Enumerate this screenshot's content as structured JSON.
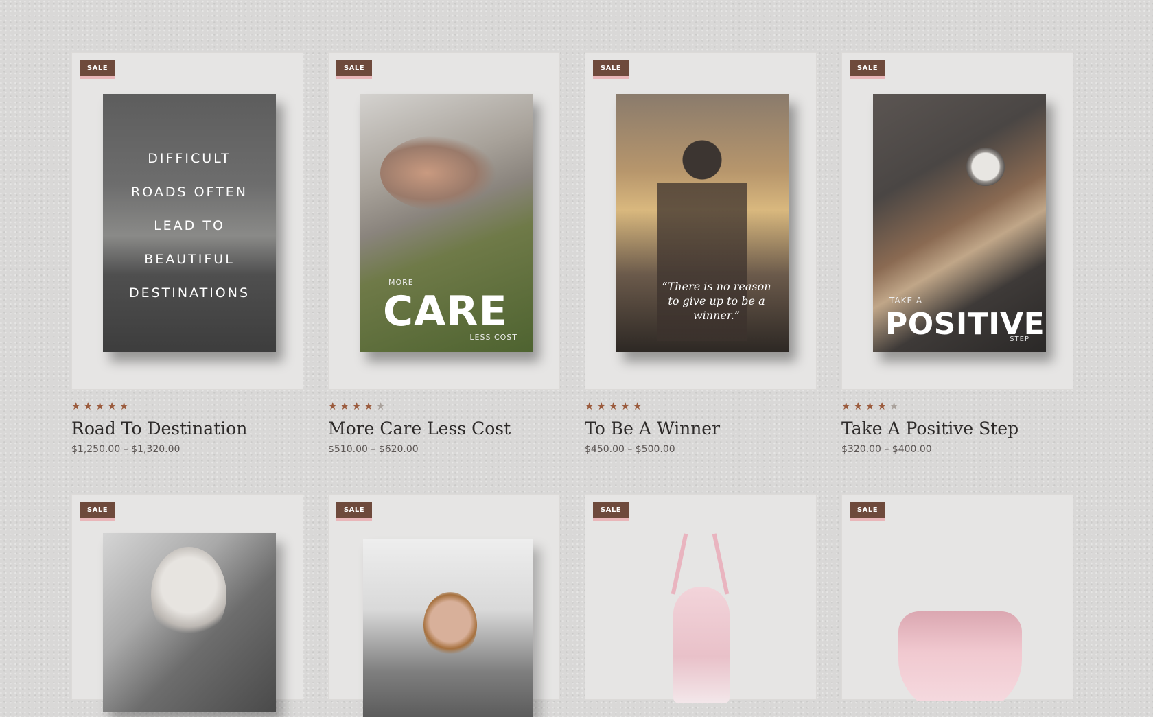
{
  "products": [
    {
      "badge": "SALE",
      "title": "Road To Destination",
      "price": "$1,250.00 – $1,320.00",
      "rating": 5,
      "cover": {
        "lines": [
          "DIFFICULT",
          "ROADS OFTEN",
          "LEAD TO",
          "BEAUTIFUL",
          "DESTINATIONS"
        ]
      }
    },
    {
      "badge": "SALE",
      "title": "More Care Less Cost",
      "price": "$510.00 – $620.00",
      "rating": 4.5,
      "cover": {
        "small_top": "MORE",
        "big": "CARE",
        "small_bottom": "LESS COST"
      }
    },
    {
      "badge": "SALE",
      "title": "To Be A Winner",
      "price": "$450.00 – $500.00",
      "rating": 5,
      "cover": {
        "quote": "“There is no reason to give up to be a winner.”"
      }
    },
    {
      "badge": "SALE",
      "title": "Take A Positive Step",
      "price": "$320.00 – $400.00",
      "rating": 4.5,
      "cover": {
        "small_top": "TAKE A",
        "big": "POSITIVE",
        "small_bottom": "STEP"
      }
    },
    {
      "badge": "SALE"
    },
    {
      "badge": "SALE"
    },
    {
      "badge": "SALE"
    },
    {
      "badge": "SALE"
    }
  ],
  "colors": {
    "badge": "#6e4a3c",
    "badge_underline": "#e9b6b9",
    "star": "#9b5b3d"
  },
  "icons": {
    "rating": "star-icon"
  }
}
